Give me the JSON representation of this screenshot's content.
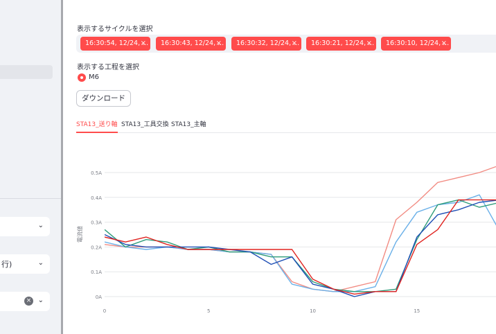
{
  "sidebar": {
    "select_2_value": "行)",
    "select_1_value": "",
    "select_3_value": ""
  },
  "cycle_select": {
    "label": "表示するサイクルを選択",
    "chips": [
      "16:30:54, 12/24, ...",
      "16:30:43, 12/24, ...",
      "16:30:32, 12/24, ...",
      "16:30:21, 12/24, ...",
      "16:30:10, 12/24, ..."
    ]
  },
  "process_select": {
    "label": "表示する工程を選択",
    "option": "M6"
  },
  "download_button": "ダウンロード",
  "tabs": [
    "STA13_送り軸",
    "STA13_工具交換",
    "STA13_主軸"
  ],
  "chart_data": {
    "type": "line",
    "ylabel": "電流値",
    "xlim": [
      0,
      18.8
    ],
    "ylim": [
      0,
      0.5
    ],
    "x_ticks": [
      "0",
      "5",
      "10",
      "15"
    ],
    "y_ticks": [
      "0A",
      "0.1A",
      "0.2A",
      "0.3A",
      "0.4A",
      "0.5A"
    ],
    "x": [
      0,
      1,
      2,
      3,
      4,
      5,
      6,
      7,
      8,
      9,
      10,
      11,
      12,
      13,
      14,
      15,
      16,
      17,
      18,
      19
    ],
    "series": [
      {
        "color": "#f28b82",
        "values": [
          0.21,
          0.2,
          0.2,
          0.2,
          0.19,
          0.19,
          0.18,
          0.18,
          0.17,
          0.06,
          0.03,
          0.02,
          0.04,
          0.06,
          0.31,
          0.38,
          0.46,
          0.48,
          0.5,
          0.53
        ]
      },
      {
        "color": "#6ab0e8",
        "values": [
          0.22,
          0.2,
          0.19,
          0.2,
          0.19,
          0.19,
          0.18,
          0.18,
          0.17,
          0.05,
          0.03,
          0.02,
          0.02,
          0.04,
          0.22,
          0.34,
          0.37,
          0.38,
          0.41,
          0.26
        ]
      },
      {
        "color": "#2e9c7a",
        "values": [
          0.27,
          0.2,
          0.23,
          0.22,
          0.19,
          0.2,
          0.18,
          0.18,
          0.16,
          0.16,
          0.06,
          0.03,
          0.02,
          0.02,
          0.03,
          0.23,
          0.37,
          0.39,
          0.36,
          0.38
        ]
      },
      {
        "color": "#1f4fb5",
        "values": [
          0.25,
          0.21,
          0.2,
          0.2,
          0.2,
          0.2,
          0.19,
          0.18,
          0.13,
          0.16,
          0.05,
          0.03,
          0.0,
          0.02,
          0.02,
          0.24,
          0.33,
          0.35,
          0.38,
          0.39
        ]
      },
      {
        "color": "#e0231f",
        "values": [
          0.24,
          0.22,
          0.24,
          0.21,
          0.19,
          0.19,
          0.19,
          0.19,
          0.19,
          0.19,
          0.07,
          0.03,
          0.01,
          0.02,
          0.02,
          0.21,
          0.27,
          0.39,
          0.39,
          0.39
        ]
      }
    ]
  }
}
